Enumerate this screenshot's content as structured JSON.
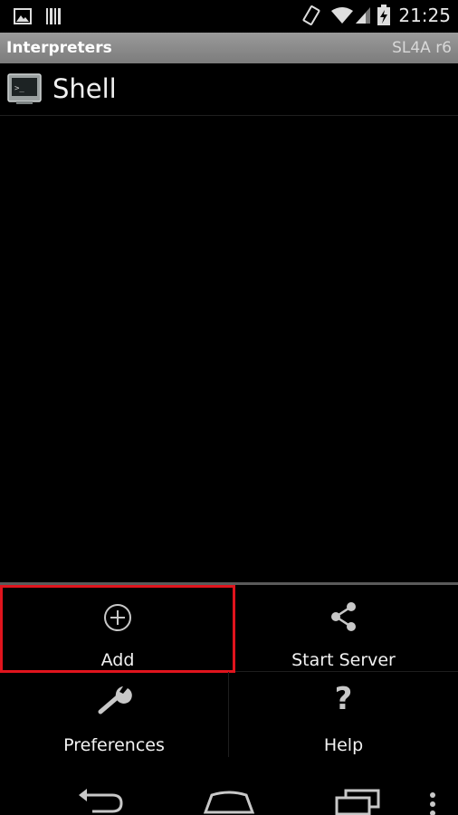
{
  "status_bar": {
    "time": "21:25",
    "icons": [
      "image-notification-icon",
      "barcode-notification-icon",
      "vibrate-icon",
      "wifi-icon",
      "signal-icon",
      "battery-charging-icon"
    ]
  },
  "title_bar": {
    "title": "Interpreters",
    "version": "SL4A r6"
  },
  "list": {
    "items": [
      {
        "label": "Shell",
        "icon": "terminal-icon"
      }
    ]
  },
  "menu": {
    "add": {
      "label": "Add",
      "icon": "add-circle-icon"
    },
    "start_server": {
      "label": "Start Server",
      "icon": "share-icon"
    },
    "preferences": {
      "label": "Preferences",
      "icon": "wrench-icon"
    },
    "help": {
      "label": "Help",
      "icon": "question-icon"
    }
  },
  "nav_bar": {
    "buttons": [
      "back-icon",
      "home-icon",
      "recent-apps-icon",
      "overflow-menu-icon"
    ]
  },
  "colors": {
    "title_bar": "#8a8a8a",
    "highlight": "#e0141d",
    "background": "#000000"
  }
}
